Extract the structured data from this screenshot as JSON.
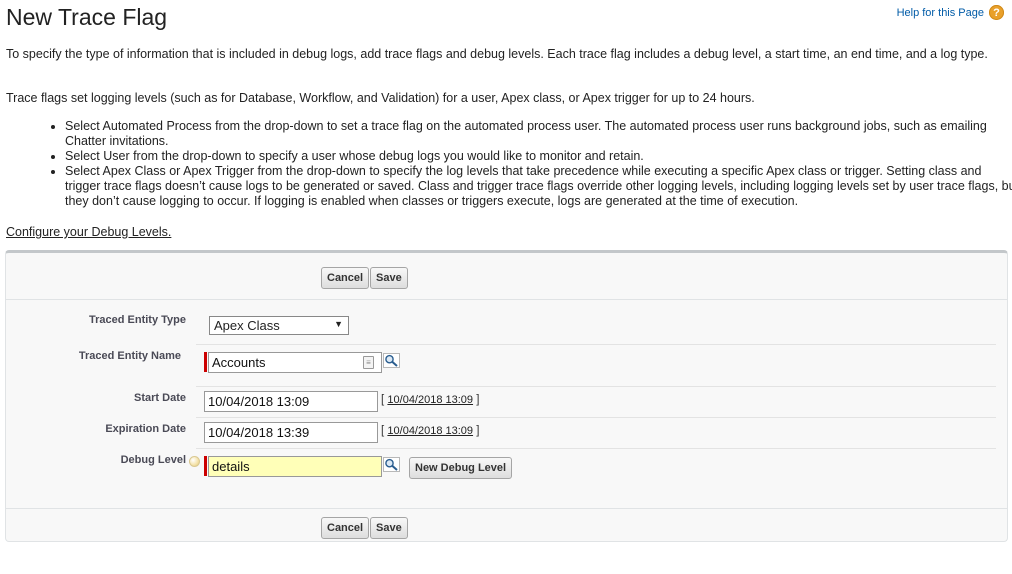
{
  "header": {
    "title": "New Trace Flag",
    "help_link": "Help for this Page",
    "help_icon": "?"
  },
  "intro": {
    "paragraph1": "To specify the type of information that is included in debug logs, add trace flags and debug levels. Each trace flag includes a debug level, a start time, an end time, and a log type.",
    "paragraph2": "Trace flags set logging levels (such as for Database, Workflow, and Validation) for a user, Apex class, or Apex trigger for up to 24 hours.",
    "bullets": [
      "Select Automated Process from the drop-down to set a trace flag on the automated process user. The automated process user runs background jobs, such as emailing Chatter invitations.",
      "Select User from the drop-down to specify a user whose debug logs you would like to monitor and retain.",
      "Select Apex Class or Apex Trigger from the drop-down to specify the log levels that take precedence while executing a specific Apex class or trigger. Setting class and trigger trace flags doesn’t cause logs to be generated or saved. Class and trigger trace flags override other logging levels, including logging levels set by user trace flags, but they don’t cause logging to occur. If logging is enabled when classes or triggers execute, logs are generated at the time of execution."
    ],
    "config_link": "Configure your Debug Levels."
  },
  "buttons": {
    "cancel": "Cancel",
    "save": "Save",
    "new_debug_level": "New Debug Level"
  },
  "form": {
    "traced_entity_type": {
      "label": "Traced Entity Type",
      "value": "Apex Class"
    },
    "traced_entity_name": {
      "label": "Traced Entity Name",
      "value": "Accounts"
    },
    "start_date": {
      "label": "Start Date",
      "value": "10/04/2018 13:09",
      "link": "10/04/2018 13:09"
    },
    "expiration_date": {
      "label": "Expiration Date",
      "value": "10/04/2018 13:39",
      "link": "10/04/2018 13:09"
    },
    "debug_level": {
      "label": "Debug Level",
      "value": "details"
    }
  },
  "text": {
    "bracket_open": "[",
    "bracket_close": "]"
  },
  "colors": {
    "required_bar": "#cc0000",
    "help_icon": "#e9a02a",
    "lookup_highlight": "#ffffb8"
  }
}
